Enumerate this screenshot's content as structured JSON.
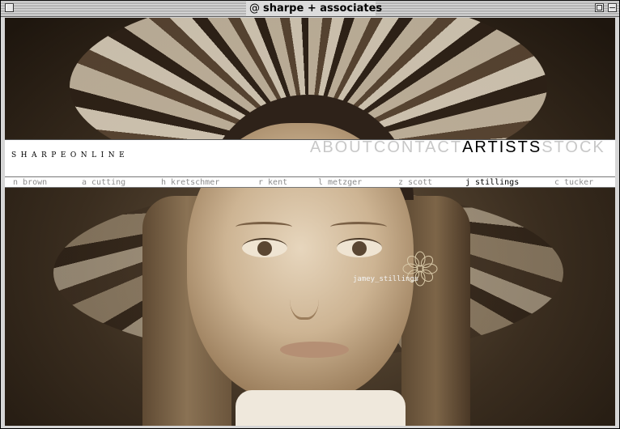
{
  "window": {
    "title": "sharpe + associates",
    "title_icon": "at-sign-icon"
  },
  "site": {
    "logo": "SHARPEONLINE",
    "nav": [
      {
        "label": "ABOUT",
        "active": false
      },
      {
        "label": "CONTACT",
        "active": false
      },
      {
        "label": "ARTISTS",
        "active": true
      },
      {
        "label": "STOCK",
        "active": false
      }
    ],
    "artists": [
      {
        "label": "n brown",
        "active": false
      },
      {
        "label": "a cutting",
        "active": false
      },
      {
        "label": "h kretschmer",
        "active": false
      },
      {
        "label": "r kent",
        "active": false
      },
      {
        "label": "l metzger",
        "active": false
      },
      {
        "label": "z scott",
        "active": false
      },
      {
        "label": "j stillings",
        "active": true
      },
      {
        "label": "c tucker",
        "active": false
      }
    ],
    "photo_caption": "jamey_stillings",
    "caption_icon": "flower-icon"
  },
  "colors": {
    "nav_inactive": "#c8c8c8",
    "nav_active": "#000000",
    "artist_inactive": "#8c8c8c",
    "sepia_dark": "#2e2219"
  }
}
